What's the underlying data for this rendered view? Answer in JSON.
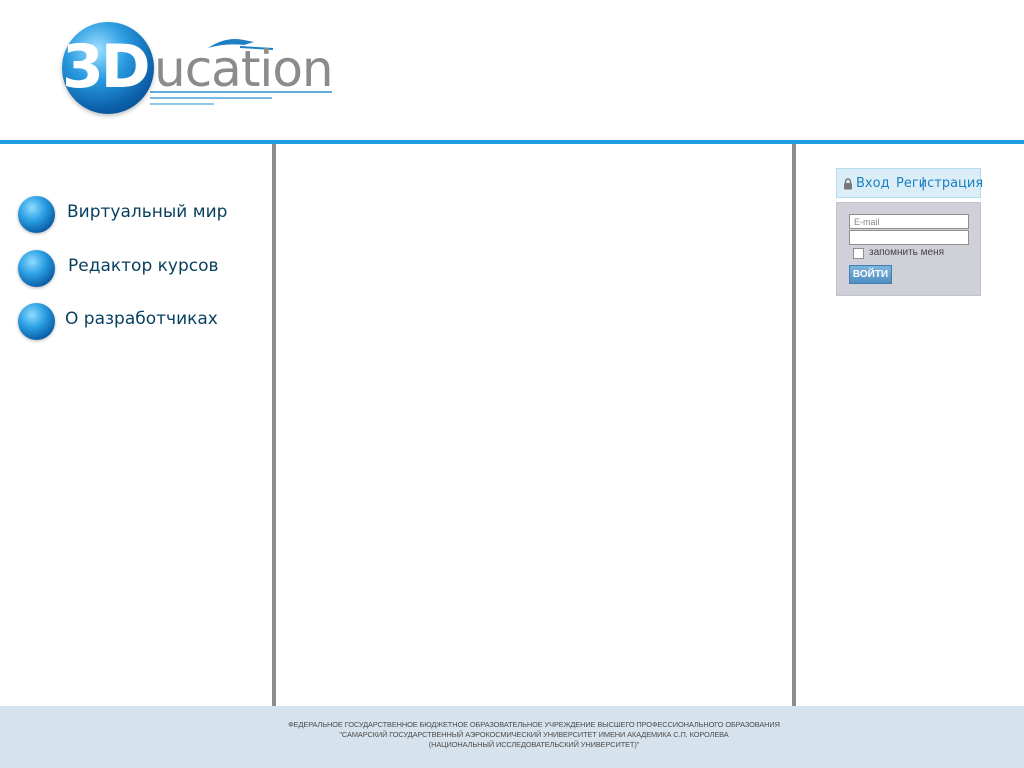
{
  "logo": {
    "mark": "3D",
    "word": "ucation"
  },
  "nav": {
    "items": [
      {
        "label": "Виртуальный мир"
      },
      {
        "label": "Редактор курсов"
      },
      {
        "label": "О разработчиках"
      }
    ]
  },
  "login": {
    "login_link": "Вход",
    "separator": "|",
    "register_link": "Регистрация",
    "email_placeholder": "E-mail",
    "password_placeholder": "",
    "remember_label": "запомнить меня",
    "remember_checked": false,
    "submit_label": "ВОЙТИ",
    "lock_icon": "lock-icon"
  },
  "footer": {
    "line1": "ФЕДЕРАЛЬНОЕ ГОСУДАРСТВЕННОЕ БЮДЖЕТНОЕ ОБРАЗОВАТЕЛЬНОЕ УЧРЕЖДЕНИЕ ВЫСШЕГО ПРОФЕССИОНАЛЬНОГО ОБРАЗОВАНИЯ",
    "line2": "\"САМАРСКИЙ ГОСУДАРСТВЕННЫЙ АЭРОКОСМИЧЕСКИЙ УНИВЕРСИТЕТ ИМЕНИ АКАДЕМИКА С.П. КОРОЛЕВА",
    "line3": "(НАЦИОНАЛЬНЫЙ ИССЛЕДОВАТЕЛЬСКИЙ УНИВЕРСИТЕТ)\""
  },
  "colors": {
    "accent": "#1e9ee0",
    "nav_text": "#073f5e",
    "divider": "#8c8c8c",
    "footer_bg": "#d6e3ec",
    "login_panel": "#cfd0d8"
  }
}
